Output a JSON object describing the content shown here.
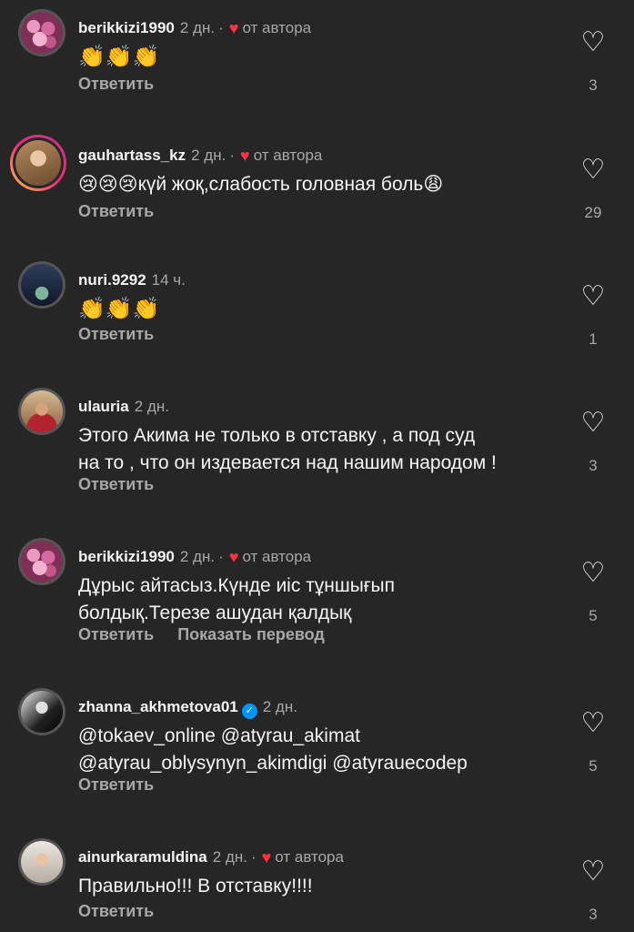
{
  "comments": [
    {
      "username": "berikkizi1990",
      "time": "2 дн.",
      "author_tag": "от автора",
      "text": "👏👏👏",
      "reply": "Ответить",
      "likes": "3"
    },
    {
      "username": "gauhartass_kz",
      "time": "2 дн.",
      "author_tag": "от автора",
      "text": "😢😢😢күй жоқ,слабость головная боль😩",
      "reply": "Ответить",
      "likes": "29"
    },
    {
      "username": "nuri.9292",
      "time": "14 ч.",
      "text": "👏👏👏",
      "reply": "Ответить",
      "likes": "1"
    },
    {
      "username": "ulauria",
      "time": "2 дн.",
      "text_lines": [
        "Этого Акима не только в отставку , а под суд",
        "на то , что он издевается над нашим народом !"
      ],
      "reply": "Ответить",
      "likes": "3"
    },
    {
      "username": "berikkizi1990",
      "time": "2 дн.",
      "author_tag": "от автора",
      "text_lines": [
        "Дұрыс айтасыз.Күнде иіс тұншығып",
        "болдық.Терезе ашудан қалдық"
      ],
      "reply": "Ответить",
      "translate": "Показать перевод",
      "likes": "5"
    },
    {
      "username": "zhanna_akhmetova01",
      "verified": "✓",
      "time": "2 дн.",
      "text_lines": [
        "@tokaev_online @atyrau_akimat",
        "@atyrau_oblysynyn_akimdigi @atyrauecodep"
      ],
      "reply": "Ответить",
      "likes": "5"
    },
    {
      "username": "ainurkaramuldina",
      "time": "2 дн.",
      "author_tag": "от автора",
      "text": "Правильно!!! В отставку!!!!",
      "reply": "Ответить",
      "likes": "3"
    }
  ],
  "icons": {
    "like": "heart-outline-icon",
    "author_like": "heart-filled-icon",
    "verified": "verified-badge-icon"
  },
  "colors": {
    "background": "#262626",
    "author_heart": "#ff3040",
    "verified": "#0095f6",
    "secondary_text": "#a8a8a8"
  }
}
